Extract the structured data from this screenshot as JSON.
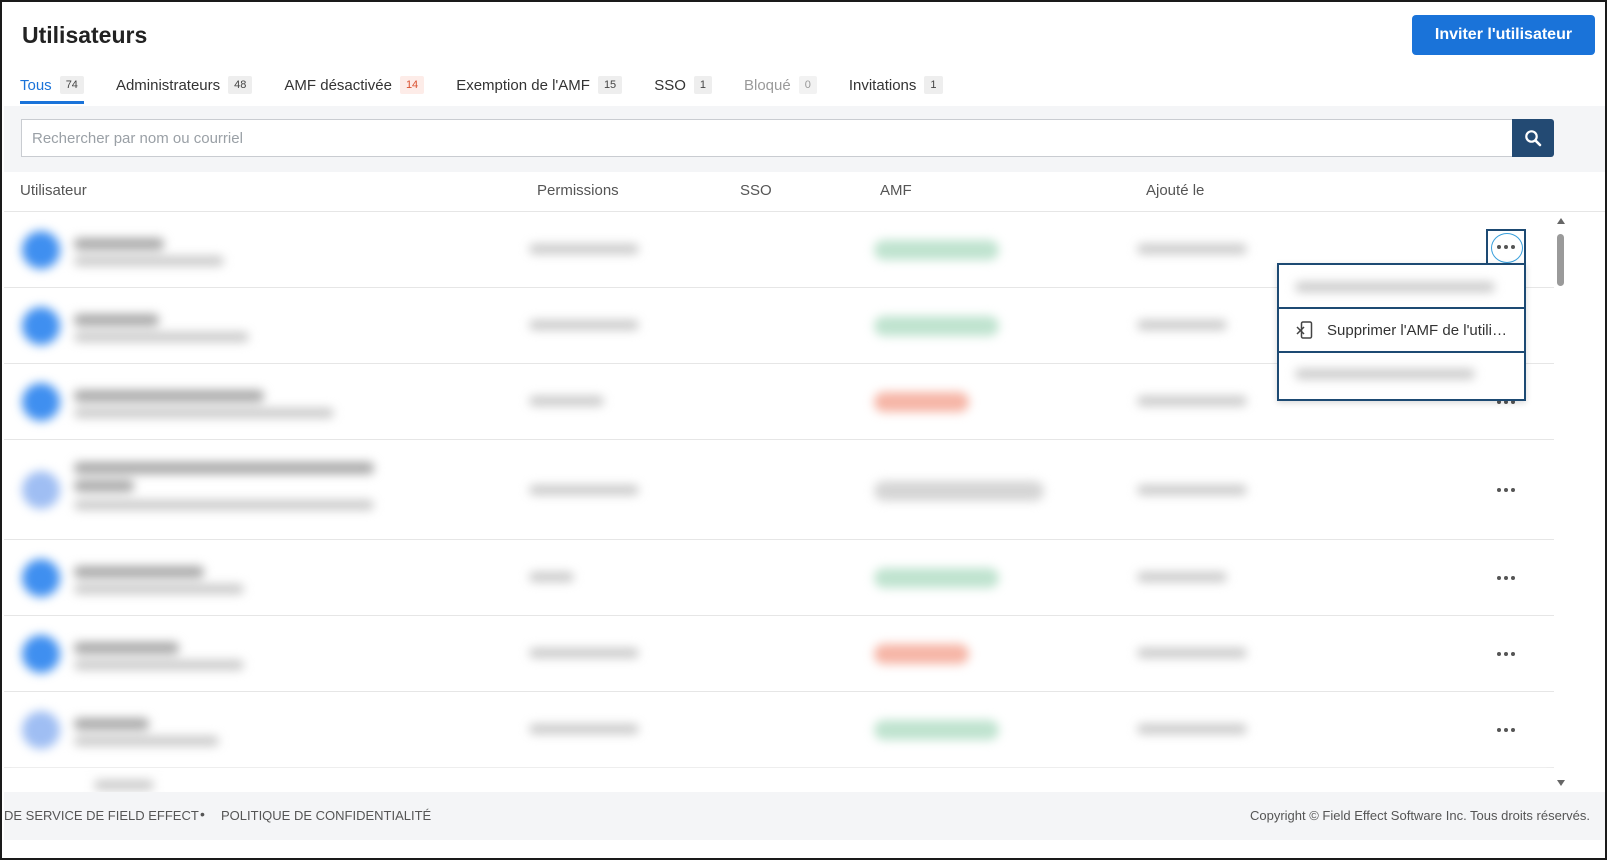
{
  "page": {
    "title": "Utilisateurs",
    "invite_label": "Inviter l'utilisateur"
  },
  "tabs": [
    {
      "label": "Tous",
      "count": "74"
    },
    {
      "label": "Administrateurs",
      "count": "48"
    },
    {
      "label": "AMF désactivée",
      "count": "14"
    },
    {
      "label": "Exemption de l'AMF",
      "count": "15"
    },
    {
      "label": "SSO",
      "count": "1"
    },
    {
      "label": "Bloqué",
      "count": "0"
    },
    {
      "label": "Invitations",
      "count": "1"
    }
  ],
  "search": {
    "placeholder": "Rechercher par nom ou courriel",
    "value": ""
  },
  "table": {
    "columns": [
      "Utilisateur",
      "Permissions",
      "SSO",
      "AMF",
      "Ajouté le"
    ]
  },
  "menu": {
    "items": [
      {
        "label": ""
      },
      {
        "label": "Supprimer l'AMF de l'utilisateur"
      },
      {
        "label": ""
      }
    ]
  },
  "footer": {
    "terms": "DE SERVICE DE FIELD EFFECT",
    "privacy": "POLITIQUE DE CONFIDENTIALITÉ",
    "copyright": "Copyright © Field Effect Software Inc. Tous droits réservés."
  },
  "colors": {
    "accent": "#1a73d9",
    "search_button": "#234a73",
    "warn": "#d9502f"
  },
  "icons": {
    "search": "search-icon",
    "more": "more-horizontal-icon",
    "remove_mfa": "remove-device-icon"
  }
}
